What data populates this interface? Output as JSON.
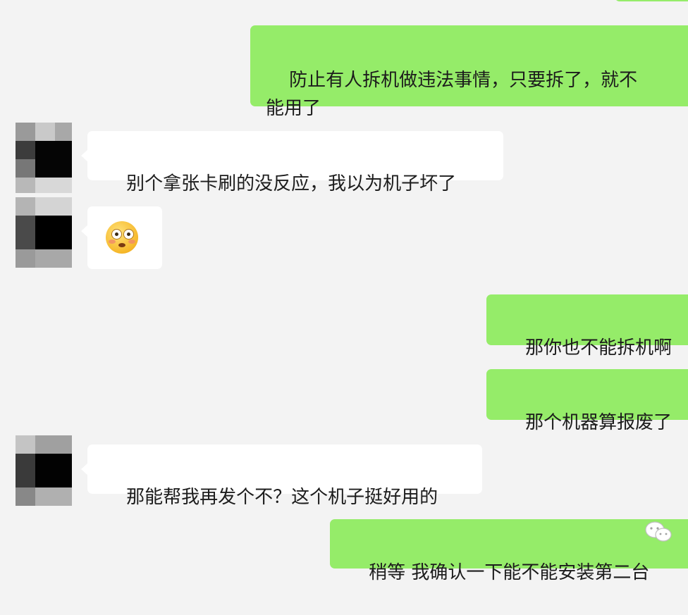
{
  "colors": {
    "background": "#f3f3f3",
    "outgoing_bubble": "#95ec69",
    "incoming_bubble": "#ffffff"
  },
  "messages": [
    {
      "side": "outgoing",
      "type": "text",
      "text": ""
    },
    {
      "side": "outgoing",
      "type": "text",
      "text": "防止有人拆机做违法事情，只要拆了，就不\n能用了"
    },
    {
      "side": "incoming",
      "type": "text",
      "text": "别个拿张卡刷的没反应，我以为机子坏了"
    },
    {
      "side": "incoming",
      "type": "emoji",
      "icon": "flushed-face-emoji"
    },
    {
      "side": "outgoing",
      "type": "text",
      "text": "那你也不能拆机啊"
    },
    {
      "side": "outgoing",
      "type": "text",
      "text": "那个机器算报废了"
    },
    {
      "side": "incoming",
      "type": "text",
      "text": "那能帮我再发个不？这个机子挺好用的"
    },
    {
      "side": "outgoing",
      "type": "text",
      "text": "稍等 我确认一下能不能安装第二台"
    }
  ],
  "avatar": {
    "pixelated": true,
    "icon": "blurred-avatar"
  },
  "watermark": {
    "icon": "wechat-logo-icon"
  }
}
